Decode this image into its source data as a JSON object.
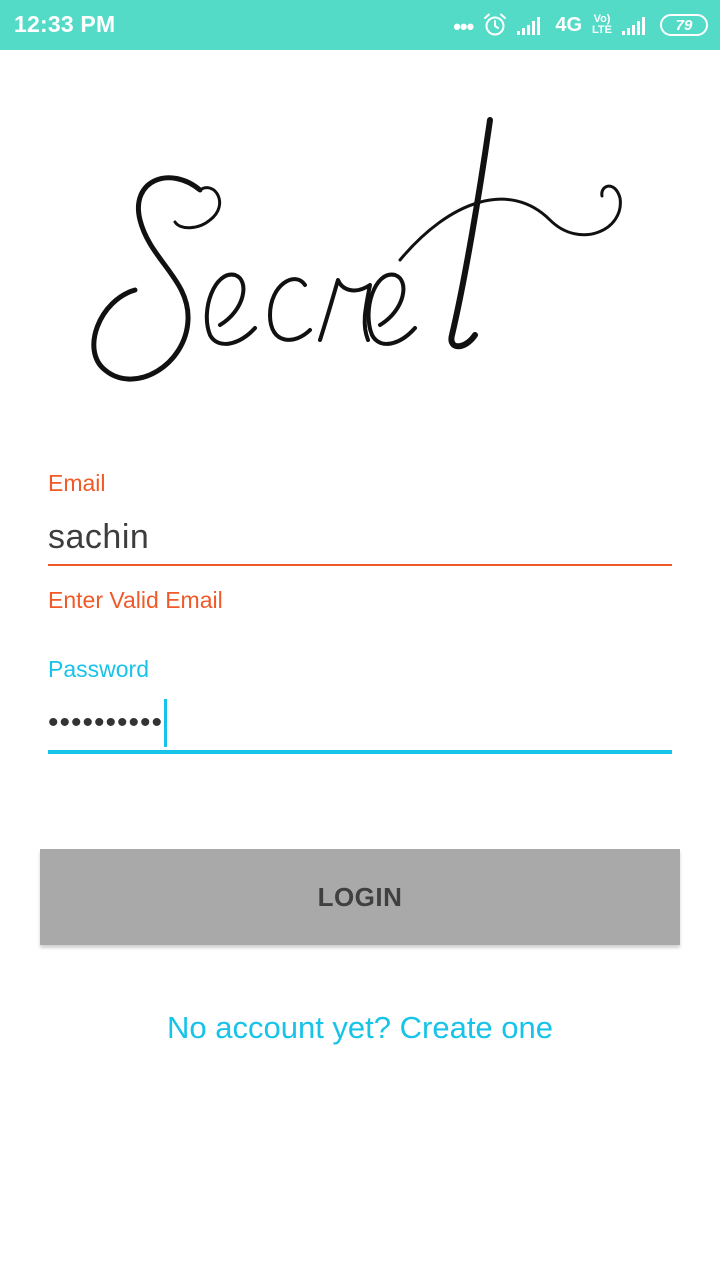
{
  "status_bar": {
    "time": "12:33 PM",
    "more_dots": "•••",
    "network": "4G",
    "volte_top": "Vo)",
    "volte_bottom": "LTE",
    "battery": "79"
  },
  "logo": {
    "text": "Secret"
  },
  "email": {
    "label": "Email",
    "value": "sachin",
    "error": "Enter Valid Email",
    "accent_color": "#f05a28"
  },
  "password": {
    "label": "Password",
    "masked_value": "••••••••••",
    "accent_color": "#17c3e8"
  },
  "login_button": {
    "label": "LOGIN",
    "color": "#a9a9a9"
  },
  "signup_link": {
    "label": "No account yet? Create one"
  },
  "colors": {
    "status_bar": "#53dbc8",
    "link": "#17c3e8"
  }
}
